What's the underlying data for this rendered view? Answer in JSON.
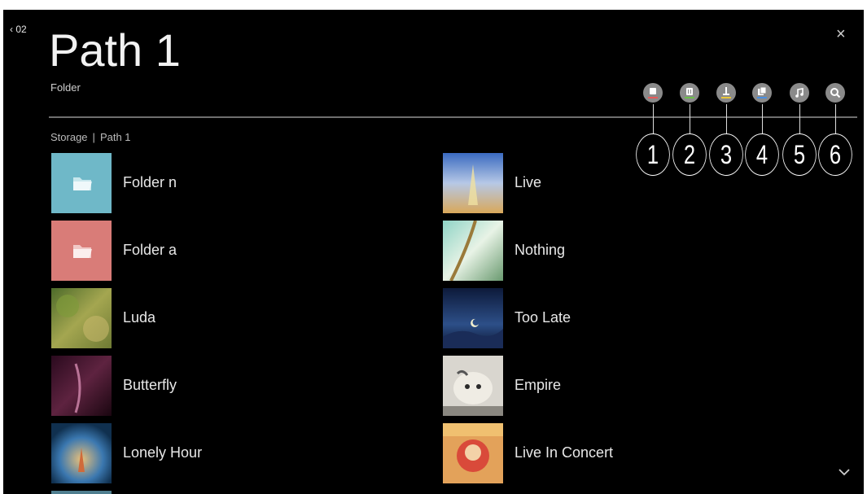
{
  "header": {
    "back_label": "‹ 02",
    "title": "Path 1",
    "subtitle": "Folder",
    "close_glyph": "×"
  },
  "breadcrumb": {
    "root": "Storage",
    "separator": "|",
    "current": "Path 1"
  },
  "toolbar": [
    {
      "icon": "view-type-icon",
      "accent": "#e85a5a",
      "callout": "1"
    },
    {
      "icon": "delete-icon",
      "accent": "#6cc04a",
      "callout": "2"
    },
    {
      "icon": "sort-icon",
      "accent": "#e8c63a",
      "callout": "3"
    },
    {
      "icon": "copy-icon",
      "accent": "#4a8fe0",
      "callout": "4"
    },
    {
      "icon": "music-player-icon",
      "accent": "none",
      "callout": "5"
    },
    {
      "icon": "search-icon",
      "accent": "none",
      "callout": "6"
    }
  ],
  "items_left": [
    {
      "label": "Folder n",
      "type": "folder",
      "color": "#6fb8c8"
    },
    {
      "label": "Folder a",
      "type": "folder",
      "color": "#d97c78"
    },
    {
      "label": "Luda",
      "type": "art"
    },
    {
      "label": "Butterfly",
      "type": "art"
    },
    {
      "label": "Lonely Hour",
      "type": "art"
    }
  ],
  "items_right": [
    {
      "label": "Live",
      "type": "art"
    },
    {
      "label": "Nothing",
      "type": "art"
    },
    {
      "label": "Too Late",
      "type": "art"
    },
    {
      "label": "Empire",
      "type": "art"
    },
    {
      "label": "Live In Concert",
      "type": "art"
    }
  ]
}
